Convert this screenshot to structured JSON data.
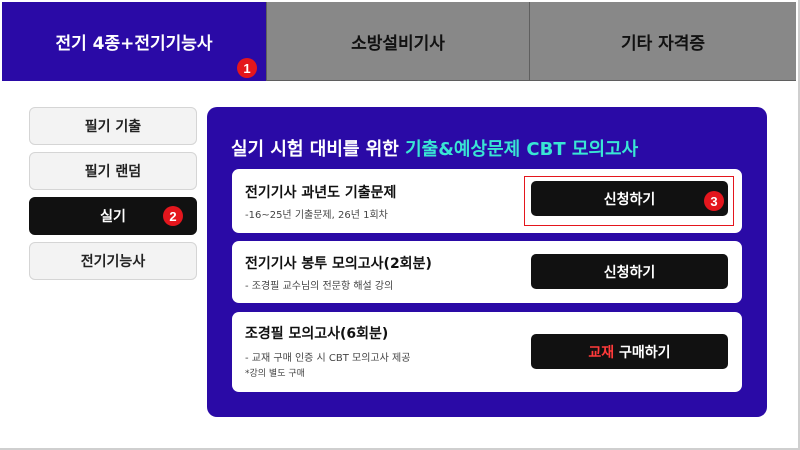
{
  "tabs": [
    {
      "label": "전기 4종+전기기능사",
      "active": true
    },
    {
      "label": "소방설비기사",
      "active": false
    },
    {
      "label": "기타 자격증",
      "active": false
    }
  ],
  "markers": [
    "1",
    "2",
    "3"
  ],
  "sidebar": {
    "items": [
      {
        "label": "필기 기출",
        "active": false
      },
      {
        "label": "필기 랜덤",
        "active": false
      },
      {
        "label": "실기",
        "active": true
      },
      {
        "label": "전기기능사",
        "active": false
      }
    ]
  },
  "panel": {
    "title_prefix": "실기 시험 대비를 위한 ",
    "title_highlight": "기출&예상문제 CBT 모의고사",
    "cards": [
      {
        "title": "전기기사 과년도 기출문제",
        "sub1": "-16~25년 기출문제, 26년 1회차",
        "sub2": "",
        "button": "신청하기"
      },
      {
        "title": "전기기사 봉투 모의고사(2회분)",
        "sub1": "- 조경필 교수님의 전문항 해설 강의",
        "sub2": "",
        "button": "신청하기"
      },
      {
        "title": "조경필 모의고사(6회분)",
        "sub1": "- 교재 구매 인증 시 CBT 모의고사 제공",
        "sub2": "*강의 별도 구매",
        "button_red": "교재",
        "button_rest": " 구매하기"
      }
    ]
  },
  "colors": {
    "brand": "#2a0aa6",
    "highlight": "#39e6d4",
    "marker": "#e4161d"
  }
}
